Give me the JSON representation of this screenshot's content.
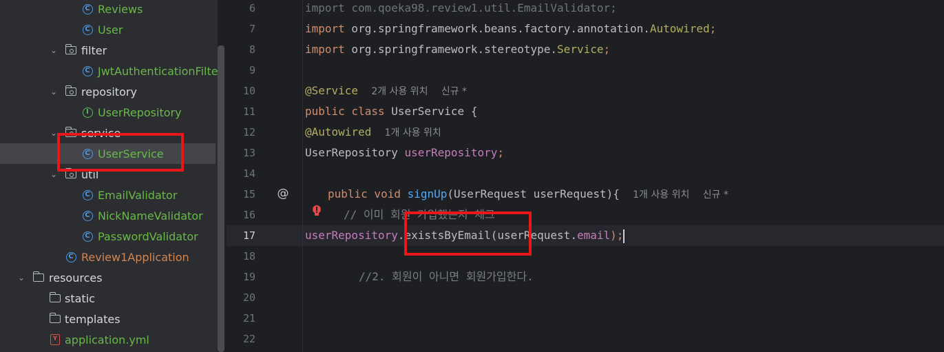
{
  "tree": {
    "items": [
      {
        "label": "Reviews",
        "kind": "class"
      },
      {
        "label": "User",
        "kind": "class"
      },
      {
        "label": "filter",
        "kind": "package"
      },
      {
        "label": "JwtAuthenticationFilter",
        "kind": "class"
      },
      {
        "label": "repository",
        "kind": "package"
      },
      {
        "label": "UserRepository",
        "kind": "interface"
      },
      {
        "label": "service",
        "kind": "package"
      },
      {
        "label": "UserService",
        "kind": "class",
        "selected": true
      },
      {
        "label": "util",
        "kind": "package"
      },
      {
        "label": "EmailValidator",
        "kind": "class"
      },
      {
        "label": "NickNameValidator",
        "kind": "class"
      },
      {
        "label": "PasswordValidator",
        "kind": "class"
      },
      {
        "label": "Review1Application",
        "kind": "app-class"
      },
      {
        "label": "resources",
        "kind": "resource-folder"
      },
      {
        "label": "static",
        "kind": "folder"
      },
      {
        "label": "templates",
        "kind": "folder"
      },
      {
        "label": "application.yml",
        "kind": "yml"
      }
    ]
  },
  "editor": {
    "line_numbers": [
      "6",
      "7",
      "8",
      "9",
      "10",
      "11",
      "12",
      "13",
      "14",
      "15",
      "16",
      "17",
      "18",
      "19",
      "20",
      "21",
      "22"
    ],
    "current_line": "17",
    "code": {
      "l6_kw": "import",
      "l6_rest": " com.qoeka98.review1.util.EmailValidator;",
      "l7_kw": "import",
      "l7_pkg": " org.springframework.beans.factory.annotation.",
      "l7_cls": "Autowired",
      "l7_end": ";",
      "l8_kw": "import",
      "l8_pkg": " org.springframework.stereotype.",
      "l8_cls": "Service",
      "l8_end": ";",
      "l10_ann": "@Service",
      "l10_hint1": "2개 사용 위치",
      "l10_hint2": "신규 *",
      "l11_kw": "public class",
      "l11_rest": " UserService {",
      "l12_ann": "@Autowired",
      "l12_hint": "1개 사용 위치",
      "l13_type": "UserRepository ",
      "l13_field": "userRepository",
      "l13_end": ";",
      "l15_kw": "public void",
      "l15_fn": " signUp",
      "l15_rest": "(UserRequest userRequest){",
      "l15_hint1": "1개 사용 위치",
      "l15_hint2": "신규 *",
      "l16_cmt": "// 이미 회원 가입했는지 체크",
      "l17_field": "userRepository",
      "l17_mid": ".existsByEmail(userRequest.",
      "l17_field2": "email",
      "l17_end": ");",
      "l19_cmt": "//2. 회원이 아니면 회원가입한다."
    },
    "gutter_icons": {
      "override": "at-icon",
      "error": "bulb-error-icon"
    }
  },
  "colors": {
    "highlight": "#e8171c",
    "background": "#1e1f22",
    "tree_background": "#2b2d30"
  }
}
